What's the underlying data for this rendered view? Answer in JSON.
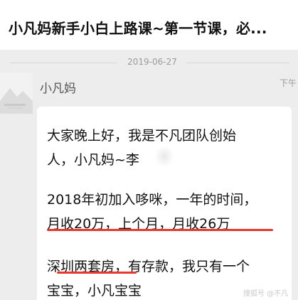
{
  "header": {
    "title": "小凡妈新手小白上路课~第一节课，必..."
  },
  "chat": {
    "date": "2019-06-27",
    "sender": "小凡妈",
    "time": "下午",
    "lines": [
      "大家晚上好，我是不凡团队创始",
      "人，小凡妈~李",
      "2018年初加入哆咪，一年的时间，",
      "月收20万，上个月，月收26万",
      "深圳两套房，有存款，我只有一个",
      "宝宝，小凡宝宝"
    ]
  },
  "watermark": "搜狐号 @不凡",
  "colors": {
    "background": "#ededed",
    "bubble": "#ffffff",
    "underline": "#e8382c",
    "text": "#111111"
  }
}
